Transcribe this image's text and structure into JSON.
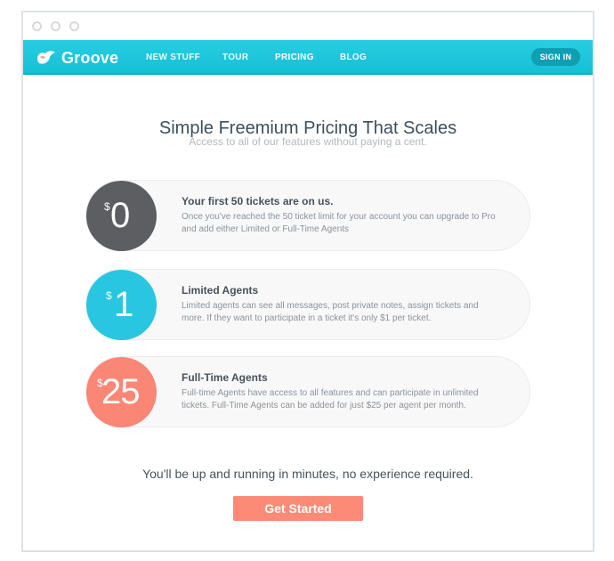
{
  "app": {
    "logo_text": "Groove"
  },
  "nav": {
    "items": [
      {
        "label": "NEW STUFF"
      },
      {
        "label": "TOUR"
      },
      {
        "label": "PRICING",
        "active": true
      },
      {
        "label": "BLOG"
      }
    ],
    "signin_label": "SIGN IN"
  },
  "hero": {
    "title": "Simple Freemium Pricing That Scales",
    "subtitle": "Access to all of our features without paying a cent."
  },
  "plans": [
    {
      "currency": "$",
      "price": "0",
      "title": "Your first 50 tickets are on us.",
      "description": "Once you've reached the 50 ticket limit for your account you can upgrade to Pro and add either Limited or Full-Time Agents",
      "color": "#5c5e61"
    },
    {
      "currency": "$",
      "price": "1",
      "title": "Limited Agents",
      "description": "Limited agents can see all messages, post private notes, assign tickets and more. If they want to participate in a ticket it's only $1 per ticket.",
      "color": "#28c6e0"
    },
    {
      "currency": "$",
      "price": "25",
      "title": "Full-Time Agents",
      "description": "Full-time Agents have access to all features and can participate in unlimited tickets. Full-Time Agents can be added for just $25 per agent per month.",
      "color": "#fa8675"
    }
  ],
  "footer": {
    "tagline": "You'll be up and running in minutes, no experience required.",
    "cta_label": "Get Started"
  },
  "colors": {
    "brand": "#1ec4da",
    "cta": "#fb8b76"
  },
  "icons": {
    "logo": "groove-logo-icon"
  }
}
